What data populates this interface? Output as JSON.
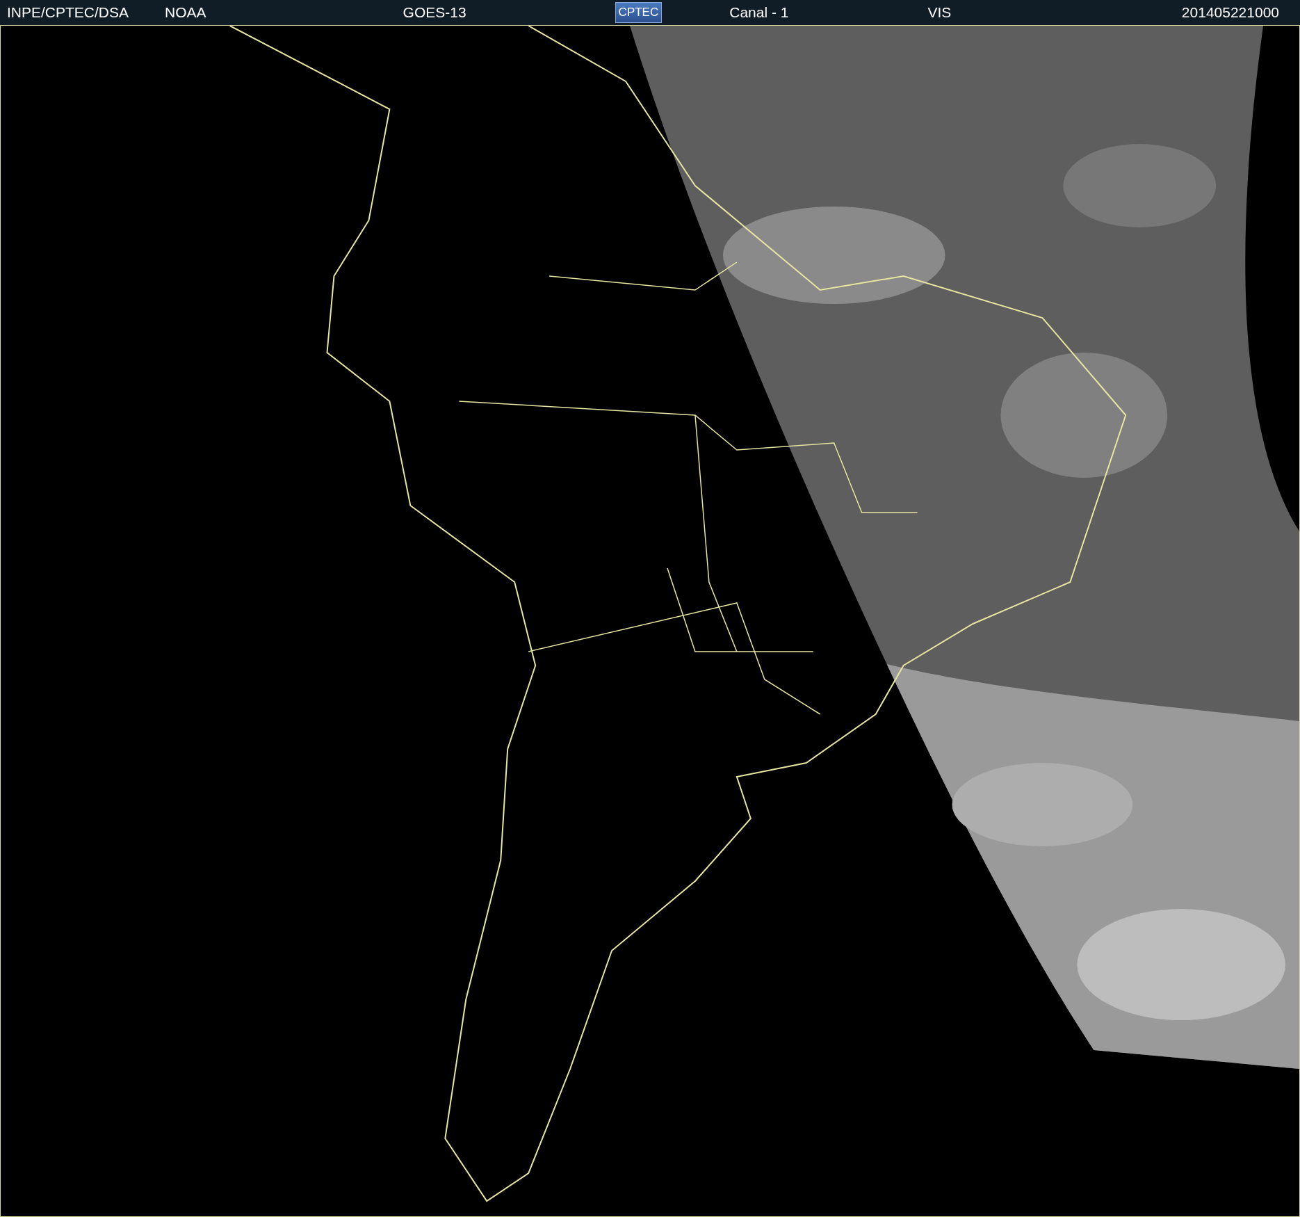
{
  "header": {
    "items": [
      {
        "kind": "text",
        "text": "INPE/CPTEC/DSA"
      },
      {
        "kind": "text",
        "text": "NOAA"
      },
      {
        "kind": "text",
        "text": "GOES-13"
      },
      {
        "kind": "logo",
        "text": "CPTEC"
      },
      {
        "kind": "text",
        "text": "Canal - 1"
      },
      {
        "kind": "text",
        "text": "VIS"
      },
      {
        "kind": "text",
        "text": "201405221000"
      }
    ]
  }
}
